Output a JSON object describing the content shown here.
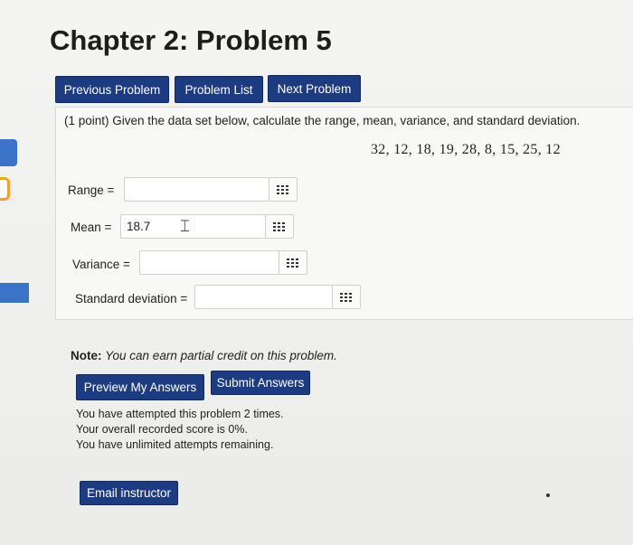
{
  "page": {
    "title": "Chapter 2: Problem 5"
  },
  "nav": {
    "previous_label": "Previous Problem",
    "list_label": "Problem List",
    "next_label": "Next Problem"
  },
  "problem": {
    "prompt": "(1 point) Given the data set below, calculate the range, mean, variance, and standard deviation.",
    "dataset": "32, 12, 18, 19, 28, 8, 15, 25, 12",
    "fields": [
      {
        "label": "Range =",
        "value": ""
      },
      {
        "label": "Mean =",
        "value": "18.7"
      },
      {
        "label": "Variance =",
        "value": ""
      },
      {
        "label": "Standard deviation =",
        "value": ""
      }
    ]
  },
  "note": {
    "bold": "Note:",
    "text": "You can earn partial credit on this problem."
  },
  "actions": {
    "preview_label": "Preview My Answers",
    "submit_label": "Submit Answers",
    "email_label": "Email instructor"
  },
  "status": {
    "line1": "You have attempted this problem 2 times.",
    "line2": "Your overall recorded score is 0%.",
    "line3": "You have unlimited attempts remaining."
  },
  "icons": {
    "answer_grid": "grid-icon",
    "text_cursor": "ibeam-cursor-icon"
  },
  "colors": {
    "button_bg": "#1c3b80",
    "accent_blue": "#3b74c6"
  }
}
